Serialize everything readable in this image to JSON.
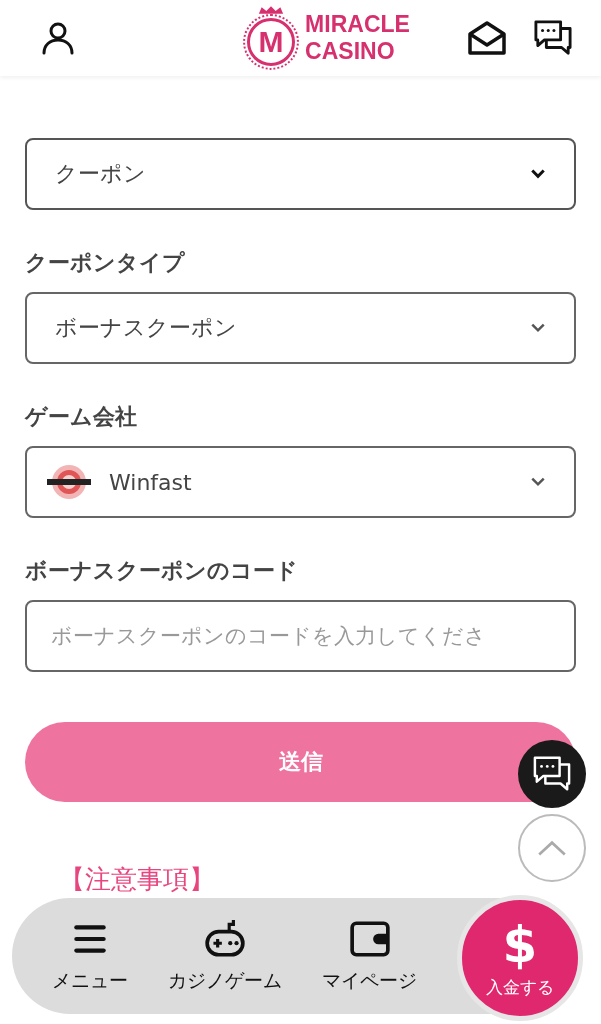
{
  "header": {
    "logo_mark": "M",
    "logo_line1": "MIRACLE",
    "logo_line2": "CASINO"
  },
  "coupon_select": {
    "value": "クーポン"
  },
  "fields": [
    {
      "kind": "select",
      "label": "クーポンタイプ",
      "value": "ボーナスクーポン"
    },
    {
      "kind": "provider",
      "label": "ゲーム会社",
      "value": "Winfast"
    },
    {
      "kind": "input",
      "label": "ボーナスクーポンのコード",
      "placeholder": "ボーナスクーポンのコードを入力してくださ"
    }
  ],
  "submit": "送信",
  "notice": {
    "title": "【注意事項】"
  },
  "nav": [
    {
      "kind": "menu",
      "label": "メニュー"
    },
    {
      "kind": "game",
      "label": "カジノゲーム"
    },
    {
      "kind": "wallet",
      "label": "マイページ"
    }
  ],
  "deposit": {
    "symbol": "$",
    "label": "入金する"
  }
}
